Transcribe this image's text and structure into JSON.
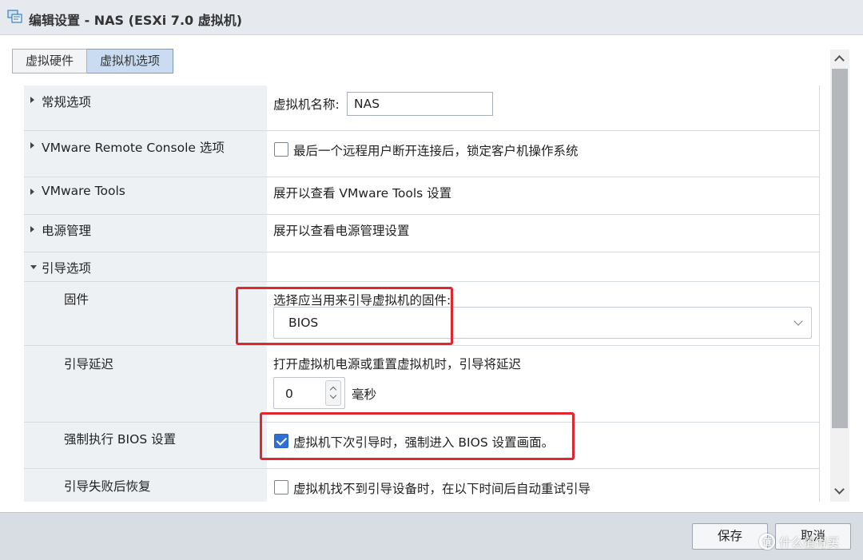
{
  "window": {
    "title": "编辑设置 - NAS (ESXi 7.0 虚拟机)",
    "icon": "vm-settings-icon"
  },
  "tabs": [
    {
      "label": "虚拟硬件",
      "active": false
    },
    {
      "label": "虚拟机选项",
      "active": true
    }
  ],
  "sections": {
    "general": {
      "label": "常规选项",
      "vm_name_label": "虚拟机名称:",
      "vm_name_value": "NAS"
    },
    "vmrc": {
      "label": "VMware Remote Console 选项",
      "lock_guest_label": "最后一个远程用户断开连接后，锁定客户机操作系统",
      "lock_guest_checked": false
    },
    "tools": {
      "label": "VMware Tools",
      "hint": "展开以查看 VMware Tools 设置"
    },
    "power": {
      "label": "电源管理",
      "hint": "展开以查看电源管理设置"
    },
    "boot": {
      "label": "引导选项",
      "firmware": {
        "label": "固件",
        "prompt": "选择应当用来引导虚拟机的固件:",
        "value": "BIOS"
      },
      "delay": {
        "label": "引导延迟",
        "prompt": "打开虚拟机电源或重置虚拟机时，引导将延迟",
        "value": "0",
        "unit": "毫秒"
      },
      "force_bios": {
        "label": "强制执行 BIOS 设置",
        "checkbox_label": "虚拟机下次引导时，强制进入 BIOS 设置画面。",
        "checked": true
      },
      "failed_recovery": {
        "label": "引导失败后恢复",
        "checkbox_label": "虚拟机找不到引导设备时，在以下时间后自动重试引导",
        "checked": false
      }
    }
  },
  "footer": {
    "save_label": "保存",
    "cancel_label": "取消"
  },
  "watermark": {
    "logo_text": "值",
    "text": "什么值得买"
  },
  "colors": {
    "accent": "#2f6fd1",
    "highlight_box": "#e0262e",
    "active_tab": "#c9dcf1"
  }
}
